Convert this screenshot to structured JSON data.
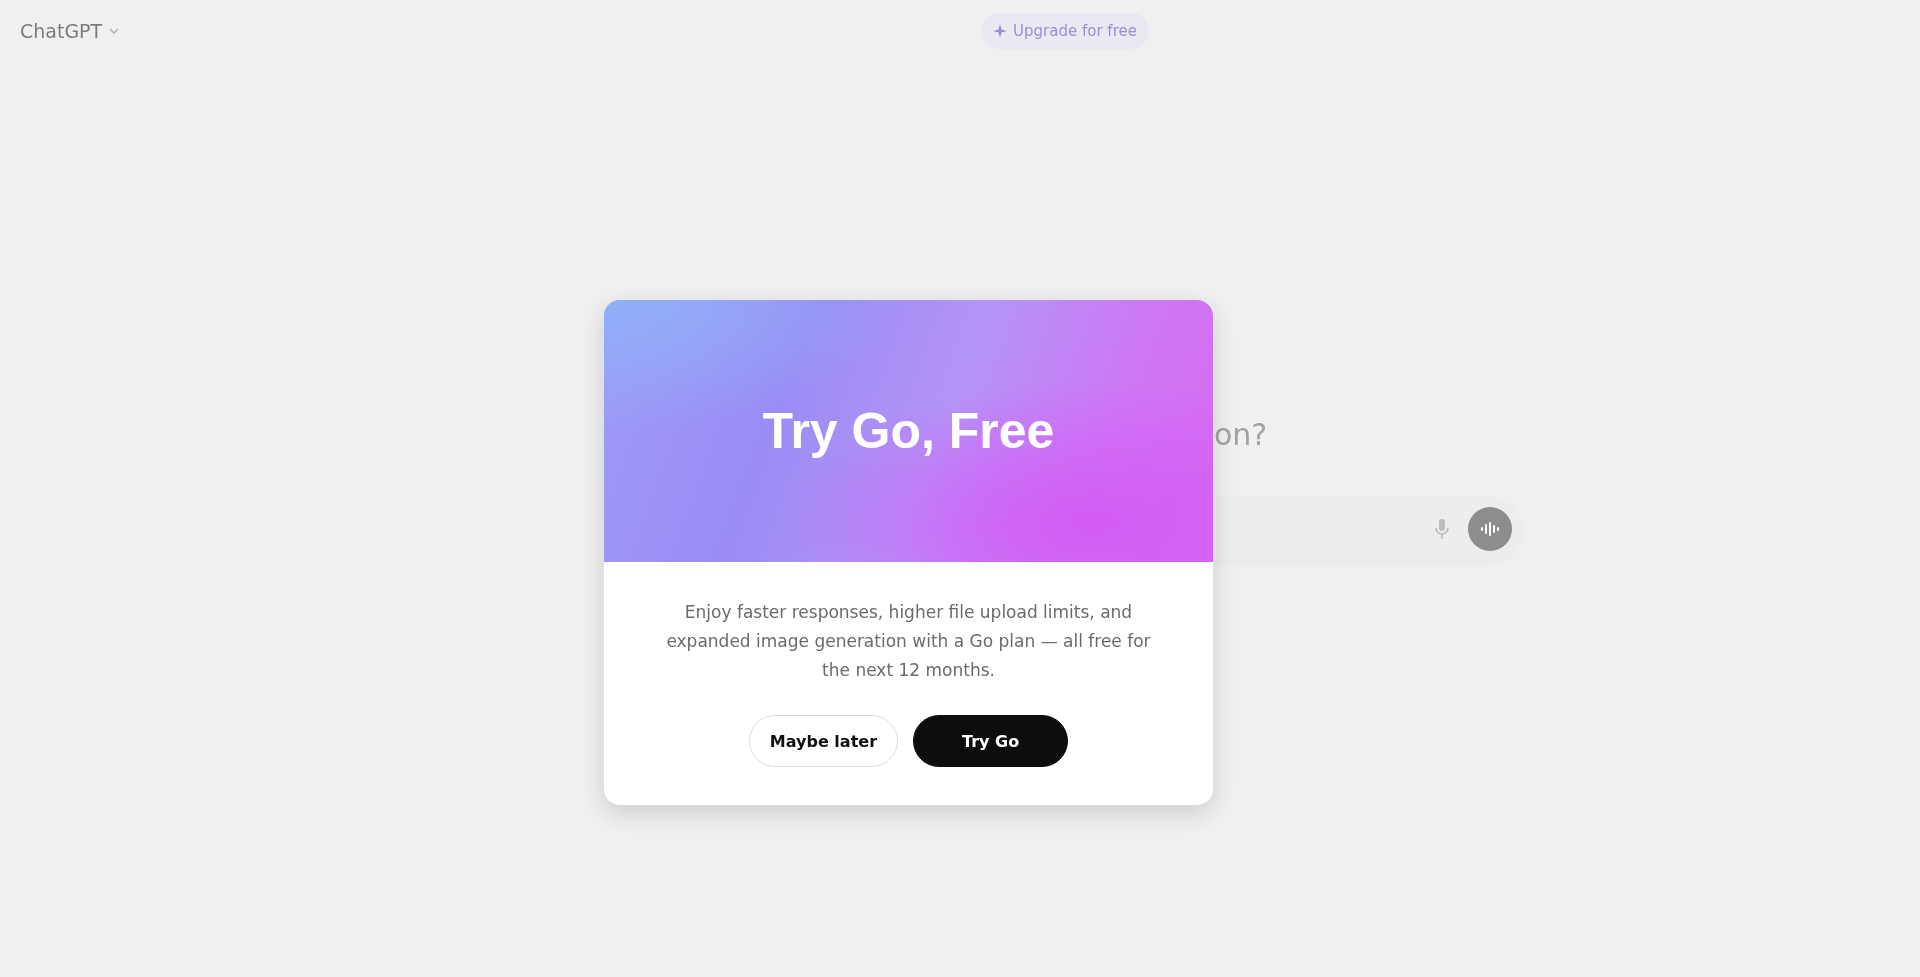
{
  "header": {
    "app_name": "ChatGPT",
    "upgrade_button": {
      "label": "Upgrade for free"
    }
  },
  "background": {
    "heading_fragment": "on?"
  },
  "modal": {
    "title": "Try Go, Free",
    "body": "Enjoy faster responses, higher file upload limits, and expanded image generation with a Go plan — all free for the next 12 months.",
    "buttons": [
      {
        "label": "Maybe later",
        "kind": "secondary"
      },
      {
        "label": "Try Go",
        "kind": "primary"
      }
    ]
  }
}
